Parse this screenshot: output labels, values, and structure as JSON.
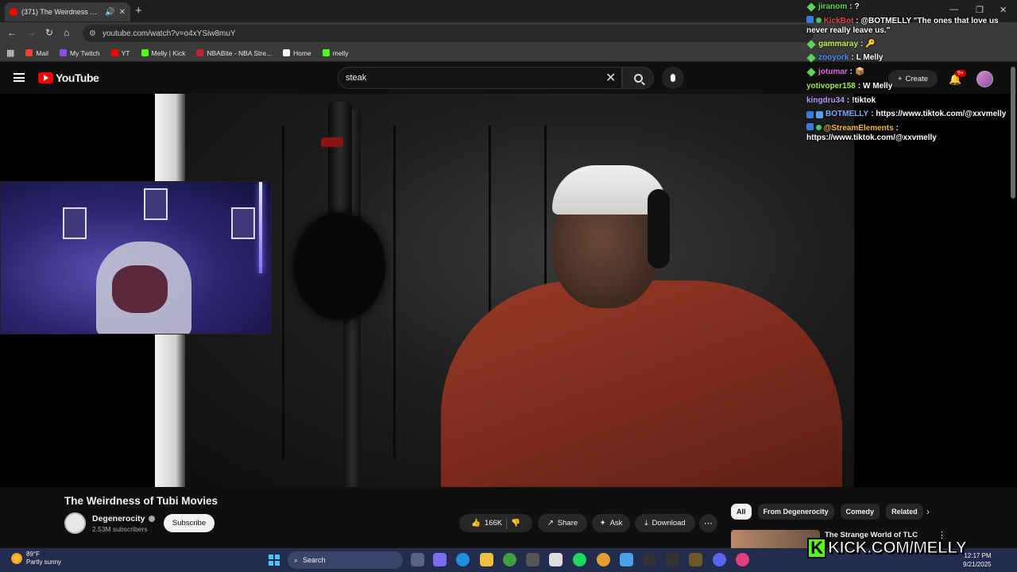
{
  "browser": {
    "tab_title": "(371) The Weirdness of Tubi",
    "url": "youtube.com/watch?v=o4xYSiw8muY",
    "bookmarks": [
      "Mail",
      "My Twitch",
      "YT",
      "Melly | Kick",
      "NBABite - NBA Stre...",
      "Home",
      "melly"
    ]
  },
  "youtube": {
    "logo_text": "YouTube",
    "search_value": "steak",
    "create_label": "Create",
    "notif_count": "9+",
    "video_title": "The Weirdness of Tubi Movies",
    "channel_name": "Degenerocity",
    "subscribers": "2.53M subscribers",
    "subscribe_label": "Subscribe",
    "like_count": "166K",
    "share_label": "Share",
    "ask_label": "Ask",
    "download_label": "Download",
    "chips": [
      "All",
      "From Degenerocity",
      "Comedy",
      "Related"
    ],
    "rec_title": "The Strange World of TLC"
  },
  "chat": [
    {
      "user": "jiranom",
      "text": "?",
      "color": "#5ad55a"
    },
    {
      "user": "KickBot",
      "text": "@BOTMELLY \"The ones that love us never really leave us.\"",
      "color": "#e04848"
    },
    {
      "user": "gammaray",
      "text": "🔑",
      "color": "#c6f04a"
    },
    {
      "user": "zooyork",
      "text": "L Melly",
      "color": "#4a8fff"
    },
    {
      "user": "jotumar",
      "text": "📦",
      "color": "#d66bd6"
    },
    {
      "user": "yotivoper158",
      "text": "W Melly",
      "color": "#9af04a"
    },
    {
      "user": "kingdru34",
      "text": "!tiktok",
      "color": "#b79cff"
    },
    {
      "user": "BOTMELLY",
      "text": "https://www.tiktok.com/@xxvmelly",
      "color": "#7aa8ff"
    },
    {
      "user": "@StreamElements",
      "text": "https://www.tiktok.com/@xxvmelly",
      "color": "#f0b840"
    }
  ],
  "taskbar": {
    "temp": "89°F",
    "weather": "Partly sunny",
    "search_label": "Search",
    "time": "12:17 PM",
    "date": "9/21/2025"
  },
  "overlay": {
    "kick_text": "KICK.COM/MELLY"
  }
}
